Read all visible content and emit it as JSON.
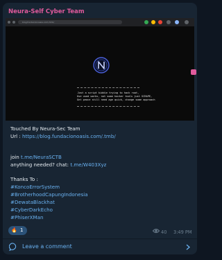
{
  "channel": {
    "name": "Neura-Self Cyber Team",
    "color": "#e05a9c"
  },
  "screenshot": {
    "address_bar": "blog.fundacionoasis.com/.tmb/",
    "message_lines": [
      "Just a script kiddie trying to hack root,",
      "Use used works, not some hacker tools just SCRAPE,",
      "Get peace still need age quick, change some approach"
    ]
  },
  "post": {
    "line1": "Touched By Neura-Sec Team",
    "url_label": "Url : ",
    "url": "https://blog.fundacionoasis.com/.tmb/",
    "join_label": "join ",
    "join_link": "t.me/NeuraSCTB",
    "chat_label": "anything needed? chat: ",
    "chat_link": "t.me/W403Xyz",
    "thanks": "Thanks To :",
    "tags": [
      "#KoncoErrorSystem",
      "#BrotherhoodCapungIndonesia",
      "#DewataBlackhat",
      "#CyberDarkEcho",
      "#PhiserXMan"
    ]
  },
  "reaction": {
    "emoji": "🔥",
    "count": "1"
  },
  "meta": {
    "views": "40",
    "time": "3:49 PM"
  },
  "footer": {
    "leave_comment": "Leave a comment"
  },
  "icons": [
    "fire-icon",
    "eye-icon",
    "comment-icon",
    "chevron-right-icon",
    "skull-logo-icon"
  ]
}
